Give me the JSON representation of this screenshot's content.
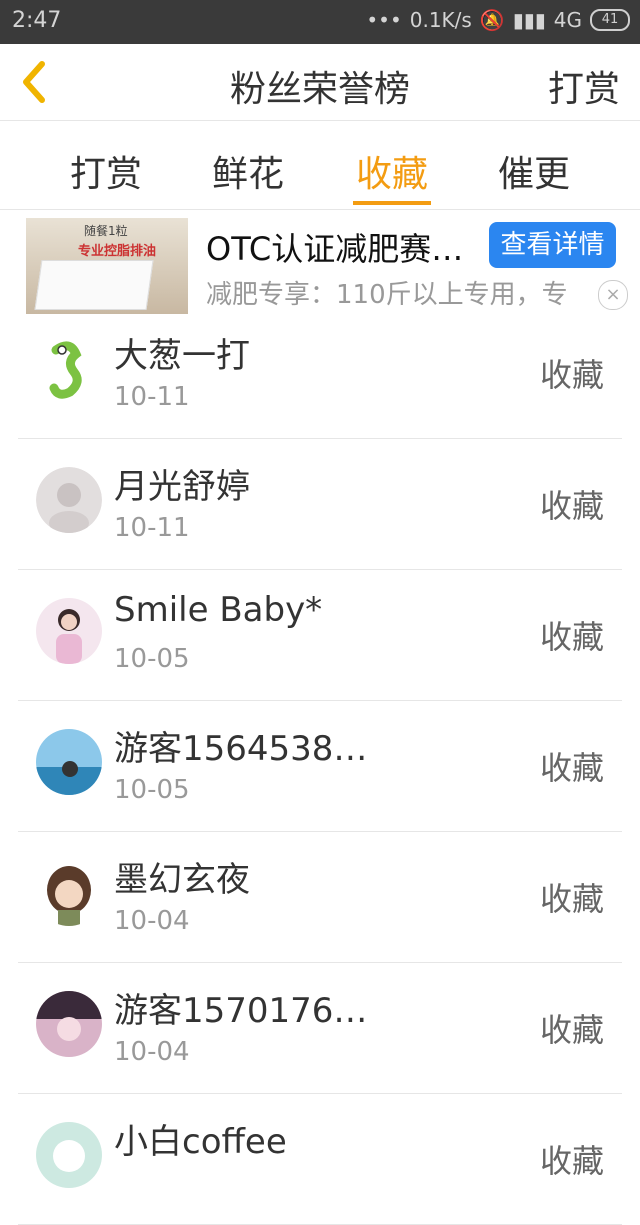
{
  "status": {
    "time": "2:47",
    "dots": "•••",
    "speed": "0.1K/s",
    "network": "4G",
    "battery": "41"
  },
  "header": {
    "title": "粉丝荣誉榜",
    "right_label": "打赏"
  },
  "tabs": [
    {
      "label": "打赏",
      "active": false
    },
    {
      "label": "鲜花",
      "active": false
    },
    {
      "label": "收藏",
      "active": true
    },
    {
      "label": "催更",
      "active": false
    }
  ],
  "ad": {
    "thumb_line1": "随餐1粒",
    "thumb_line2": "专业控脂排油",
    "title": "OTC认证减肥赛…",
    "button": "查看详情",
    "desc": "减肥专享：110斤以上专用，专",
    "close": "×"
  },
  "list": [
    {
      "name": "大葱一打",
      "date": "10-11",
      "action": "收藏",
      "avatar_color": "#7cc242"
    },
    {
      "name": "月光舒婷",
      "date": "10-11",
      "action": "收藏",
      "avatar_color": "#d8d2d2"
    },
    {
      "name": "Smile Baby*",
      "date": "10-05",
      "action": "收藏",
      "avatar_color": "#e6bcd8"
    },
    {
      "name": "游客1564538…",
      "date": "10-05",
      "action": "收藏",
      "avatar_color": "#4aa3d8"
    },
    {
      "name": "墨幻玄夜",
      "date": "10-04",
      "action": "收藏",
      "avatar_color": "#6b4a36"
    },
    {
      "name": "游客1570176…",
      "date": "10-04",
      "action": "收藏",
      "avatar_color": "#c9a0b7"
    },
    {
      "name": "小白coffee",
      "date": "",
      "action": "收藏",
      "avatar_color": "#a9d6c9"
    }
  ]
}
